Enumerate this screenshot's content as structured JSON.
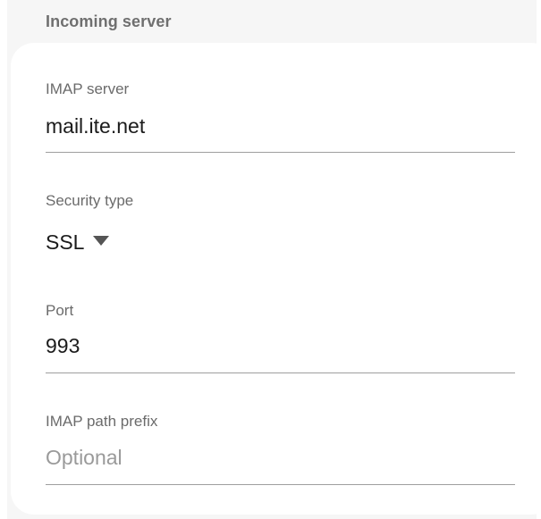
{
  "section": {
    "title": "Incoming server"
  },
  "fields": {
    "imap_server": {
      "label": "IMAP server",
      "value": "mail.ite.net"
    },
    "security_type": {
      "label": "Security type",
      "value": "SSL",
      "icon": "caret-down-icon"
    },
    "port": {
      "label": "Port",
      "value": "993"
    },
    "imap_path_prefix": {
      "label": "IMAP path prefix",
      "value": "",
      "placeholder": "Optional"
    }
  },
  "colors": {
    "background": "#f6f6f6",
    "card": "#ffffff",
    "label": "#6b6b6b",
    "value": "#1b1b1b",
    "placeholder": "#9a9a9a",
    "divider": "#9e9e9e"
  }
}
